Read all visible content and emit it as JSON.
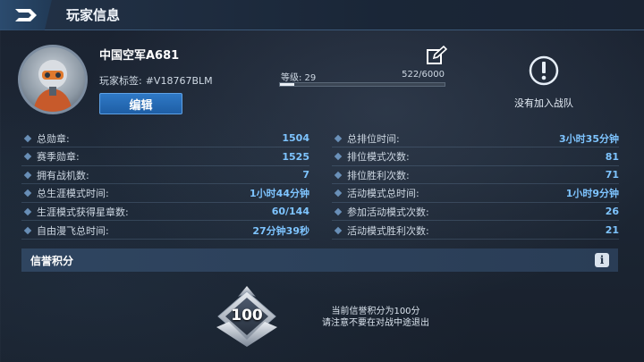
{
  "header": {
    "title": "玩家信息"
  },
  "profile": {
    "name": "中国空军A681",
    "tag_label": "玩家标签:",
    "tag_value": "#V18767BLM",
    "edit_label": "编辑",
    "level_label": "等级: 29",
    "exp_text": "522/6000",
    "exp_progress": 0.087,
    "team_status": "没有加入战队"
  },
  "stats_left": [
    {
      "label": "总勋章:",
      "value": "1504"
    },
    {
      "label": "赛季勋章:",
      "value": "1525"
    },
    {
      "label": "拥有战机数:",
      "value": "7"
    },
    {
      "label": "总生涯模式时间:",
      "value": "1小时44分钟"
    },
    {
      "label": "生涯模式获得星章数:",
      "value": "60/144"
    },
    {
      "label": "自由漫飞总时间:",
      "value": "27分钟39秒"
    }
  ],
  "stats_right": [
    {
      "label": "总排位时间:",
      "value": "3小时35分钟"
    },
    {
      "label": "排位模式次数:",
      "value": "81"
    },
    {
      "label": "排位胜利次数:",
      "value": "71"
    },
    {
      "label": "活动模式总时间:",
      "value": "1小时9分钟"
    },
    {
      "label": "参加活动模式次数:",
      "value": "26"
    },
    {
      "label": "活动模式胜利次数:",
      "value": "21"
    }
  ],
  "reputation": {
    "title": "信誉积分",
    "score": "100",
    "message_line1": "当前信誉积分为100分",
    "message_line2": "请注意不要在对战中途退出"
  },
  "colors": {
    "accent_blue": "#2f79c6",
    "stat_value": "#7ec4ff"
  },
  "icons": {
    "back": "back-arrow-logo-icon",
    "edit": "edit-pencil-icon",
    "team": "exclamation-alert-icon",
    "info": "info-icon",
    "badge": "reputation-badge-icon"
  }
}
